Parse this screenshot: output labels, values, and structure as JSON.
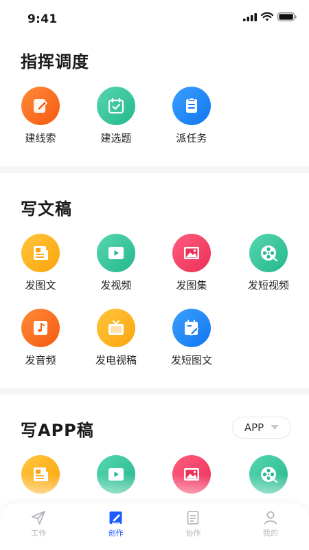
{
  "status": {
    "time": "9:41"
  },
  "command": {
    "title": "指挥调度",
    "items": [
      {
        "label": "建线索",
        "color": "orange",
        "icon": "pencil-square-icon"
      },
      {
        "label": "建选题",
        "color": "teal",
        "icon": "calendar-check-icon"
      },
      {
        "label": "派任务",
        "color": "blue",
        "icon": "task-list-icon"
      }
    ]
  },
  "write": {
    "title": "写文稿",
    "items": [
      {
        "label": "发图文",
        "color": "yellow",
        "icon": "image-text-icon"
      },
      {
        "label": "发视频",
        "color": "teal",
        "icon": "video-play-icon"
      },
      {
        "label": "发图集",
        "color": "pink",
        "icon": "image-icon"
      },
      {
        "label": "发短视频",
        "color": "teal",
        "icon": "film-reel-icon"
      },
      {
        "label": "发音频",
        "color": "orange",
        "icon": "music-note-icon"
      },
      {
        "label": "发电视稿",
        "color": "yellow",
        "icon": "tv-icon"
      },
      {
        "label": "发短图文",
        "color": "blue",
        "icon": "short-image-text-icon"
      }
    ]
  },
  "app": {
    "title": "写APP稿",
    "select_value": "APP",
    "items": [
      {
        "color": "yellow",
        "icon": "image-text-icon"
      },
      {
        "color": "teal",
        "icon": "video-play-icon"
      },
      {
        "color": "pink",
        "icon": "image-icon"
      },
      {
        "color": "teal",
        "icon": "film-reel-icon"
      }
    ]
  },
  "tabs": [
    {
      "label": "工作",
      "icon": "send-icon",
      "active": false
    },
    {
      "label": "创作",
      "icon": "edit-square-icon",
      "active": true
    },
    {
      "label": "协作",
      "icon": "document-icon",
      "active": false
    },
    {
      "label": "我的",
      "icon": "user-icon",
      "active": false
    }
  ],
  "colors": {
    "accent": "#1a5cff",
    "tab_inactive": "#b3b6bd"
  }
}
